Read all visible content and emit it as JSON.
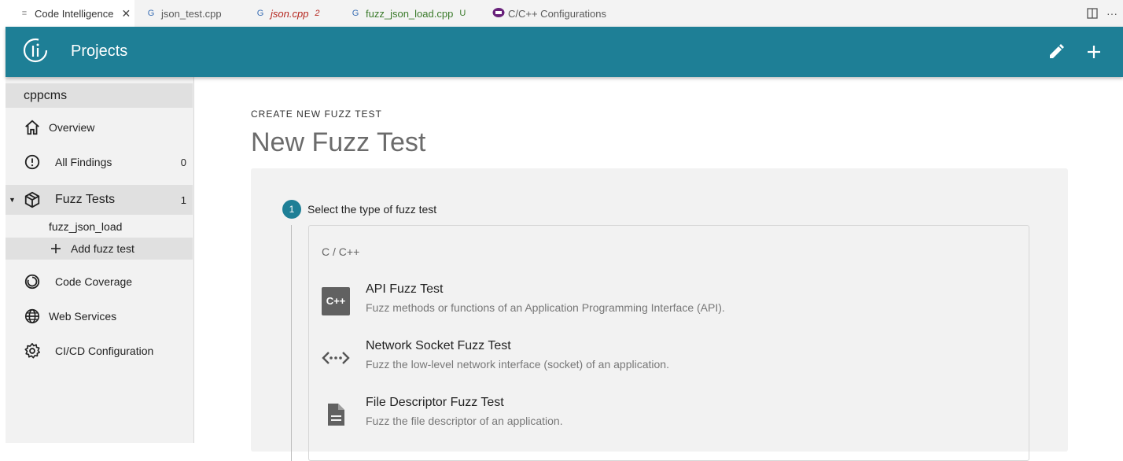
{
  "tabs": [
    {
      "label": "Code Intelligence",
      "icon": "preview-icon",
      "active": true
    },
    {
      "label": "json_test.cpp",
      "icon": "cpp-file-icon",
      "active": false
    },
    {
      "label": "json.cpp",
      "badge": "2",
      "icon": "cpp-file-icon",
      "active": false
    },
    {
      "label": "fuzz_json_load.cpp",
      "badge": "U",
      "icon": "cpp-file-icon",
      "active": false
    },
    {
      "label": "C/C++ Configurations",
      "icon": "settings-file-icon",
      "active": false
    }
  ],
  "header": {
    "title": "Projects",
    "color": "#1e7f96"
  },
  "sidebar": {
    "project": "cppcms",
    "items": [
      {
        "label": "Overview",
        "icon": "home-icon"
      },
      {
        "label": "All Findings",
        "count": "0",
        "icon": "alert-circle-icon"
      },
      {
        "label": "Fuzz Tests",
        "count": "1",
        "icon": "cube-icon"
      },
      {
        "label": "fuzz_json_load"
      },
      {
        "label": "Add fuzz test",
        "icon": "plus-icon"
      },
      {
        "label": "Code Coverage",
        "icon": "coverage-icon"
      },
      {
        "label": "Web Services",
        "icon": "globe-icon"
      },
      {
        "label": "CI/CD Configuration",
        "icon": "gear-icon"
      }
    ]
  },
  "main": {
    "overline": "CREATE NEW FUZZ TEST",
    "title": "New Fuzz Test",
    "step": {
      "number": "1",
      "label": "Select the type of fuzz test"
    },
    "group": "C / C++",
    "options": [
      {
        "title": "API Fuzz Test",
        "desc": "Fuzz methods or functions of an Application Programming Interface (API).",
        "icon_text": "C++",
        "icon": "cpp-icon"
      },
      {
        "title": "Network Socket Fuzz Test",
        "desc": "Fuzz the low-level network interface (socket) of an application.",
        "icon": "network-socket-icon"
      },
      {
        "title": "File Descriptor Fuzz Test",
        "desc": "Fuzz the file descriptor of an application.",
        "icon": "file-icon"
      }
    ]
  }
}
